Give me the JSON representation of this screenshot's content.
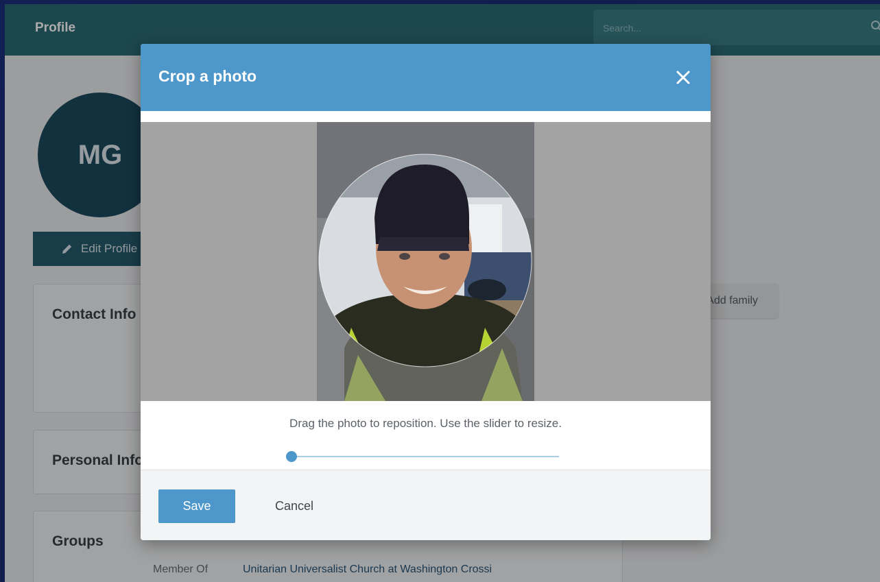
{
  "page": {
    "title": "Profile",
    "search_placeholder": "Search...",
    "search_icon": "search-icon"
  },
  "profile": {
    "initials": "MG",
    "edit_label": "Edit Profile",
    "edit_icon": "pencil-icon"
  },
  "cards": {
    "contact_title": "Contact Info",
    "personal_title": "Personal Info",
    "groups_title": "Groups",
    "member_of_label": "Member Of",
    "member_of_value": "Unitarian Universalist Church at Washington Crossi"
  },
  "family": {
    "label": "Add family"
  },
  "modal": {
    "title": "Crop a photo",
    "close_icon": "close-icon",
    "hint": "Drag the photo to reposition. Use the slider to resize.",
    "zoom_level": 0.02,
    "save_label": "Save",
    "cancel_label": "Cancel",
    "accent_color": "#4e97cb"
  }
}
